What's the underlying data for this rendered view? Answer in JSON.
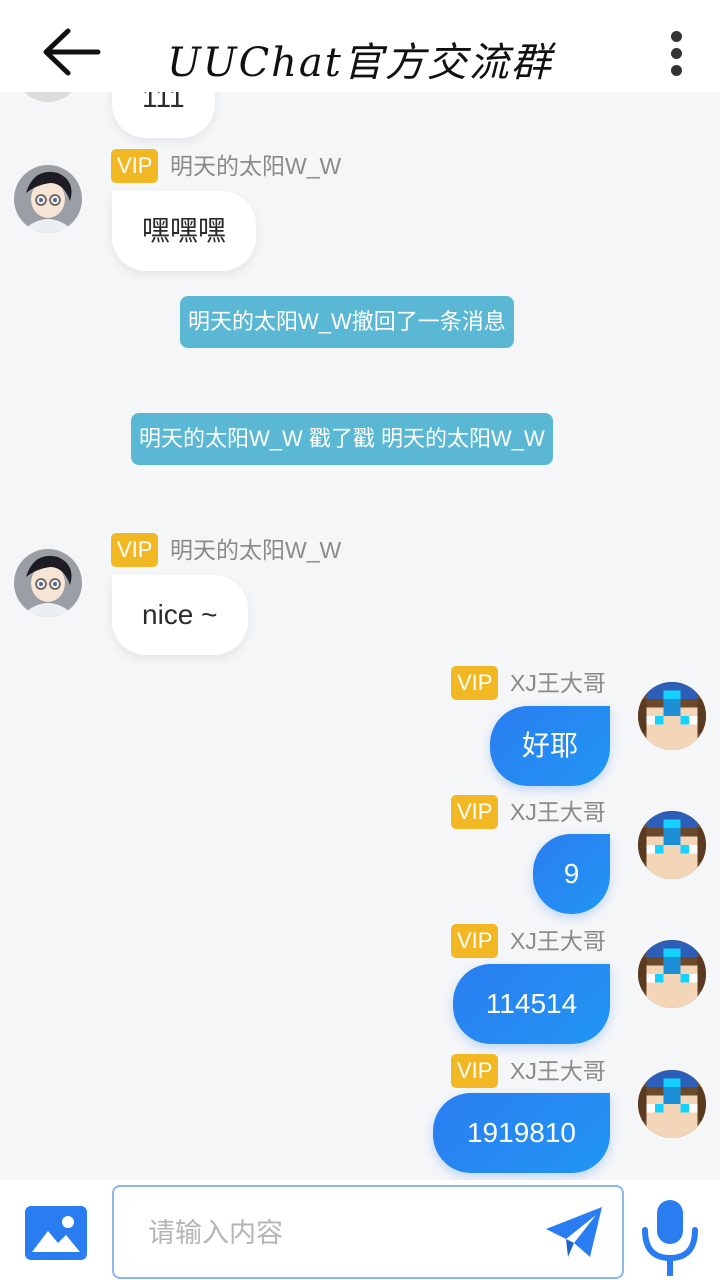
{
  "header": {
    "back_icon": "arrow-left-icon",
    "title": "UUChat官方交流群",
    "more_icon": "more-vertical-icon"
  },
  "messages": [
    {
      "side": "left",
      "text": "111",
      "partial": true
    },
    {
      "side": "left",
      "badge": "VIP",
      "name": "明天的太阳W_W",
      "text": "嘿嘿嘿"
    },
    {
      "type": "system",
      "text": "明天的太阳W_W撤回了一条消息"
    },
    {
      "type": "system",
      "text": "明天的太阳W_W 戳了戳 明天的太阳W_W"
    },
    {
      "side": "left",
      "badge": "VIP",
      "name": "明天的太阳W_W",
      "text": "nice ~"
    },
    {
      "side": "right",
      "badge": "VIP",
      "name": "XJ王大哥",
      "text": "好耶"
    },
    {
      "side": "right",
      "badge": "VIP",
      "name": "XJ王大哥",
      "text": "9"
    },
    {
      "side": "right",
      "badge": "VIP",
      "name": "XJ王大哥",
      "text": "114514"
    },
    {
      "side": "right",
      "badge": "VIP",
      "name": "XJ王大哥",
      "text": "1919810"
    }
  ],
  "input": {
    "placeholder": "请输入内容",
    "value": ""
  },
  "bottom": {
    "image_icon": "image-icon",
    "send_icon": "send-icon",
    "mic_icon": "microphone-icon"
  },
  "colors": {
    "vip_badge": "#f1b824",
    "system_notice": "#5ab8d4",
    "right_bubble": "#2a7df0",
    "icon_blue": "#2a7df0"
  }
}
